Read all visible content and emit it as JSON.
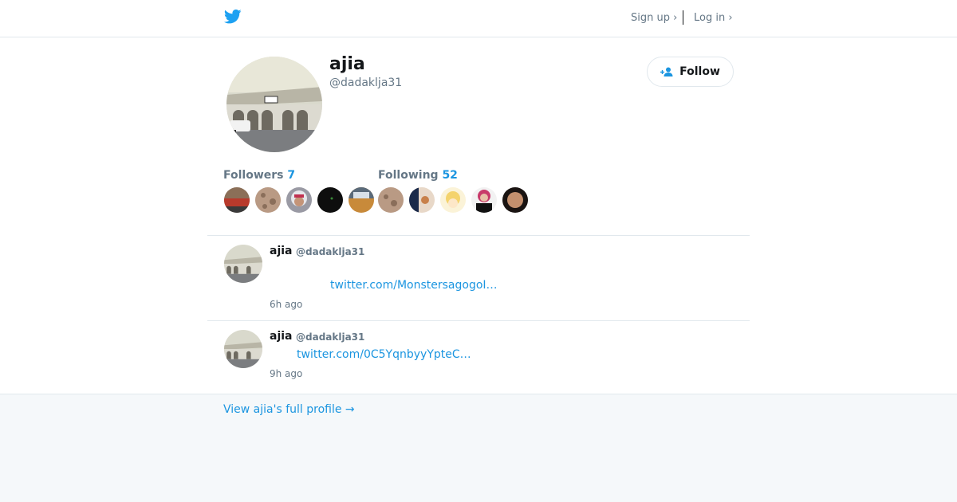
{
  "nav": {
    "signup": "Sign up ›",
    "login": "Log in ›"
  },
  "profile": {
    "name": "ajia",
    "handle": "@dadaklja31"
  },
  "follow_button": {
    "label": "Follow"
  },
  "stats": {
    "followers_label": "Followers",
    "followers_count": "7",
    "following_label": "Following",
    "following_count": "52"
  },
  "tweets": [
    {
      "name": "ajia",
      "handle": "@dadaklja31",
      "link": "twitter.com/MonstersagogoI…",
      "time": "6h ago"
    },
    {
      "name": "ajia",
      "handle": "@dadaklja31",
      "link": "twitter.com/0C5YqnbyyYpteC…",
      "time": "9h ago"
    }
  ],
  "footer": {
    "link": "View ajia's full profile →"
  },
  "colors": {
    "accent": "#1b95e0",
    "twitter_blue": "#1da1f2",
    "muted": "#657786",
    "border": "#e1e8ed"
  }
}
